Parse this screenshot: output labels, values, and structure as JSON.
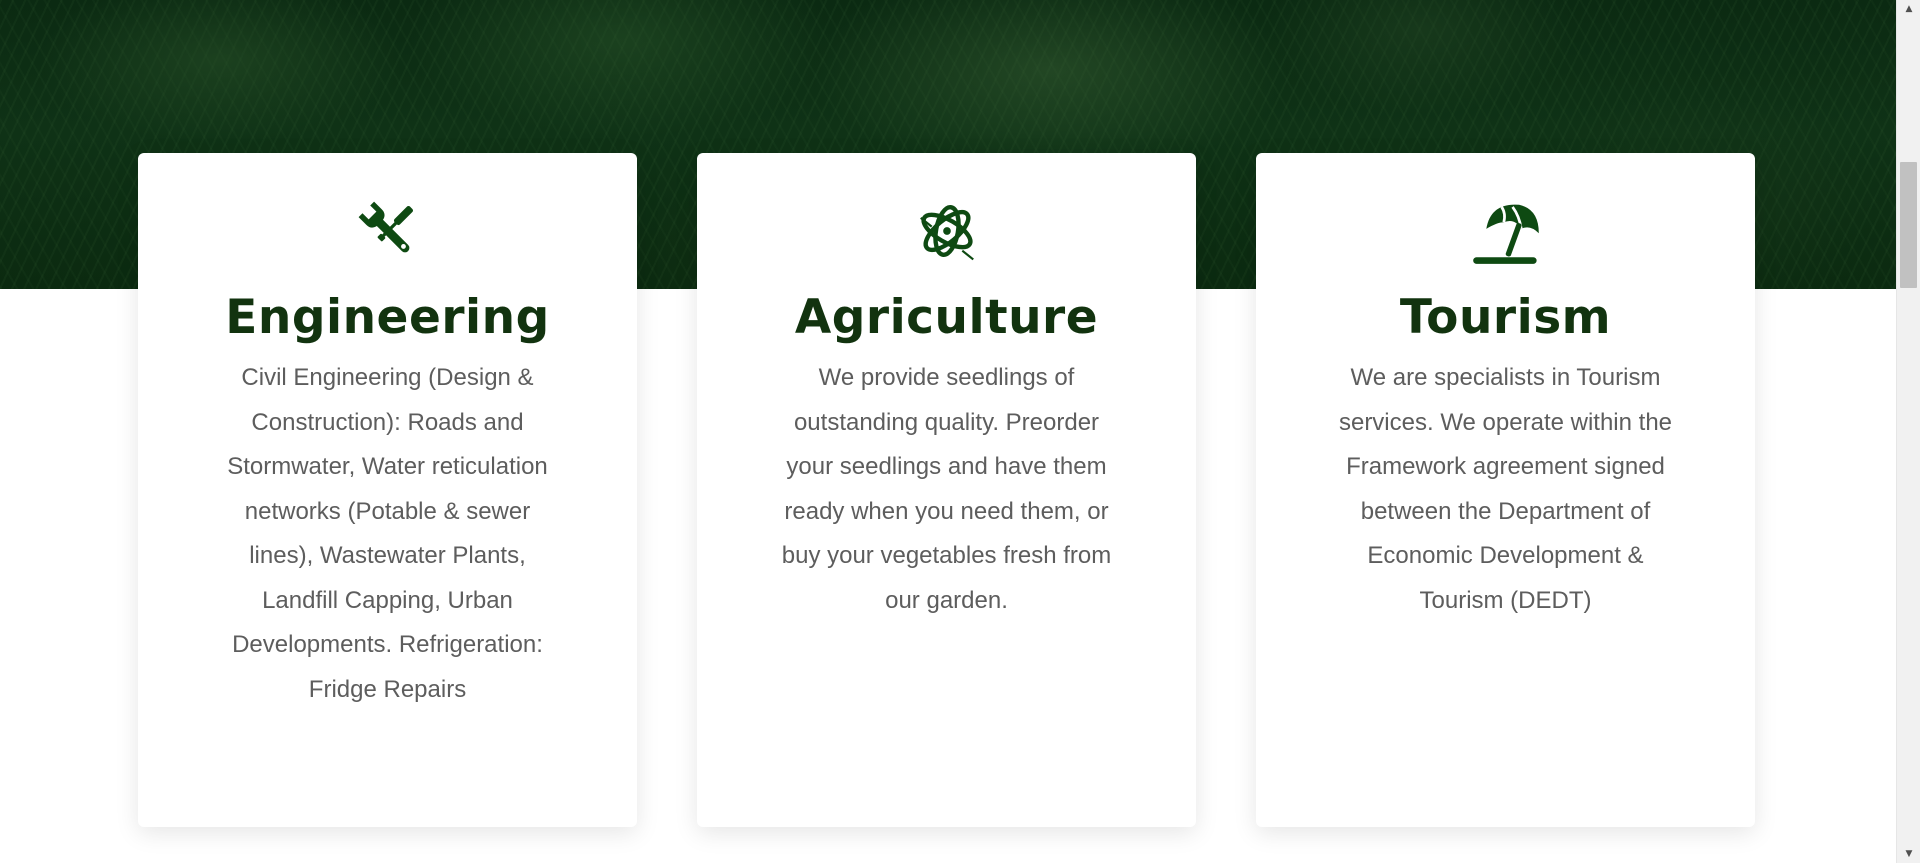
{
  "colors": {
    "hero_background": "#0f3216",
    "icon_green": "#0e4a12",
    "title_green": "#12330f",
    "body_text": "#5d5d5d",
    "card_background": "#ffffff"
  },
  "services": [
    {
      "icon": "tools-icon",
      "title": "Engineering",
      "description": "Civil Engineering (Design & Construction): Roads and Stormwater, Water reticulation networks (Potable & sewer lines), Wastewater Plants, Landfill Capping, Urban Developments. Refrigeration: Fridge Repairs"
    },
    {
      "icon": "atom-leaf-icon",
      "title": "Agriculture",
      "description": "We provide seedlings of outstanding quality. Preorder your seedlings and have them ready when you need them, or buy your vegetables fresh from our garden."
    },
    {
      "icon": "beach-umbrella-icon",
      "title": "Tourism",
      "description": "We are specialists in Tourism services. We operate within the Framework agreement signed between the Department of Economic Development & Tourism (DEDT)"
    }
  ],
  "scrollbar": {
    "up_arrow_icon": "scroll-up-arrow-icon",
    "down_arrow_icon": "scroll-down-arrow-icon"
  }
}
